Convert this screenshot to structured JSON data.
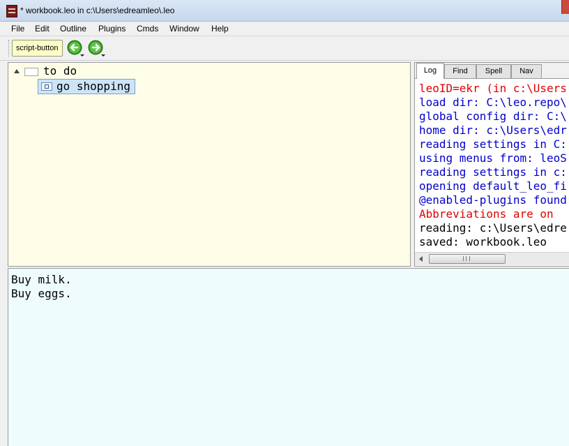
{
  "window": {
    "title": "* workbook.leo in c:\\Users\\edreamleo\\.leo",
    "icon": "leo-app-icon"
  },
  "menu": {
    "items": [
      "File",
      "Edit",
      "Outline",
      "Plugins",
      "Cmds",
      "Window",
      "Help"
    ]
  },
  "toolbar": {
    "script_button_label": "script-button",
    "back_icon": "back-arrow-icon",
    "forward_icon": "forward-arrow-icon"
  },
  "outline": {
    "nodes": [
      {
        "label": "to do",
        "expanded": true,
        "selected": false
      },
      {
        "label": "go shopping",
        "expanded": false,
        "selected": true
      }
    ]
  },
  "log": {
    "tabs": [
      "Log",
      "Find",
      "Spell",
      "Nav"
    ],
    "active_tab": "Log",
    "lines": [
      {
        "text": "leoID=ekr (in c:\\Users",
        "color": "#e00000"
      },
      {
        "text": "load dir: C:\\leo.repo\\",
        "color": "#0000cc"
      },
      {
        "text": "global config dir: C:\\",
        "color": "#0000cc"
      },
      {
        "text": "home dir: c:\\Users\\edr",
        "color": "#0000cc"
      },
      {
        "text": "reading settings in C:",
        "color": "#0000cc"
      },
      {
        "text": "using menus from: leoS",
        "color": "#0000cc"
      },
      {
        "text": "reading settings in c:",
        "color": "#0000cc"
      },
      {
        "text": "opening default_leo_fi",
        "color": "#0000cc"
      },
      {
        "text": "@enabled-plugins found",
        "color": "#0000cc"
      },
      {
        "text": "Abbreviations are on",
        "color": "#e00000"
      },
      {
        "text": "reading: c:\\Users\\edre",
        "color": "#000000"
      },
      {
        "text": "saved: workbook.leo",
        "color": "#000000"
      }
    ]
  },
  "body": {
    "lines": [
      "Buy milk.",
      "Buy eggs."
    ]
  },
  "colors": {
    "outline_bg": "#fdfde8",
    "body_bg": "#eefcfe",
    "selection": "#cde4f8"
  }
}
